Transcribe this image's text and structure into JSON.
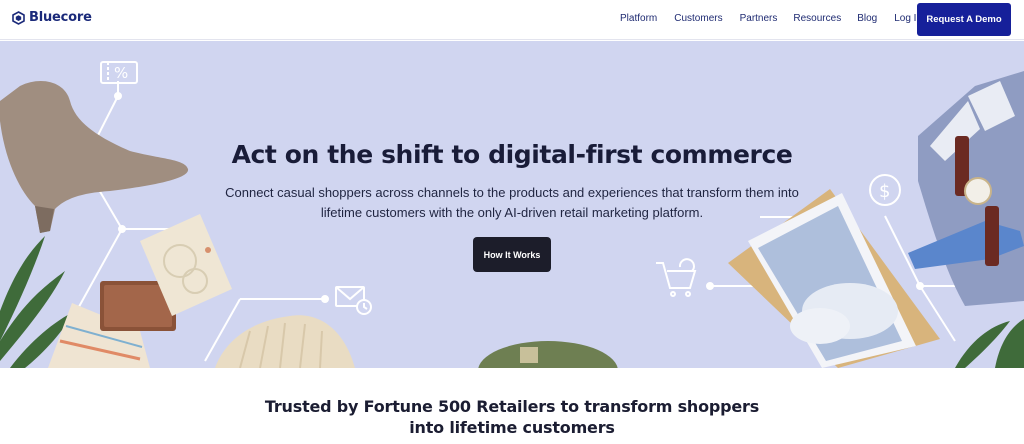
{
  "brand": {
    "name": "Bluecore",
    "color": "#1b2a7a"
  },
  "nav": {
    "links": [
      "Platform",
      "Customers",
      "Partners",
      "Resources",
      "Blog",
      "Log In"
    ],
    "cta_label": "Request A Demo",
    "cta_color": "#16209a"
  },
  "hero": {
    "headline": "Act on the shift to digital-first commerce",
    "subhead_line1": "Connect casual shoppers across channels to the products and experiences that transform them into",
    "subhead_line2": "lifetime customers with the only AI-driven retail marketing platform.",
    "button_label": "How It Works",
    "background": "#d0d5f0",
    "decorative_items": [
      "coupon-icon",
      "ankle-boot",
      "wallet",
      "notebook",
      "email-clock-icon",
      "cart-refresh-icon",
      "dollar-icon",
      "tablet",
      "dress-shirt",
      "wristwatch",
      "tie",
      "leaves",
      "pillow",
      "fringed-scarf"
    ]
  },
  "trusted": {
    "line1": "Trusted by Fortune 500 Retailers to transform shoppers",
    "line2": "into lifetime customers"
  }
}
